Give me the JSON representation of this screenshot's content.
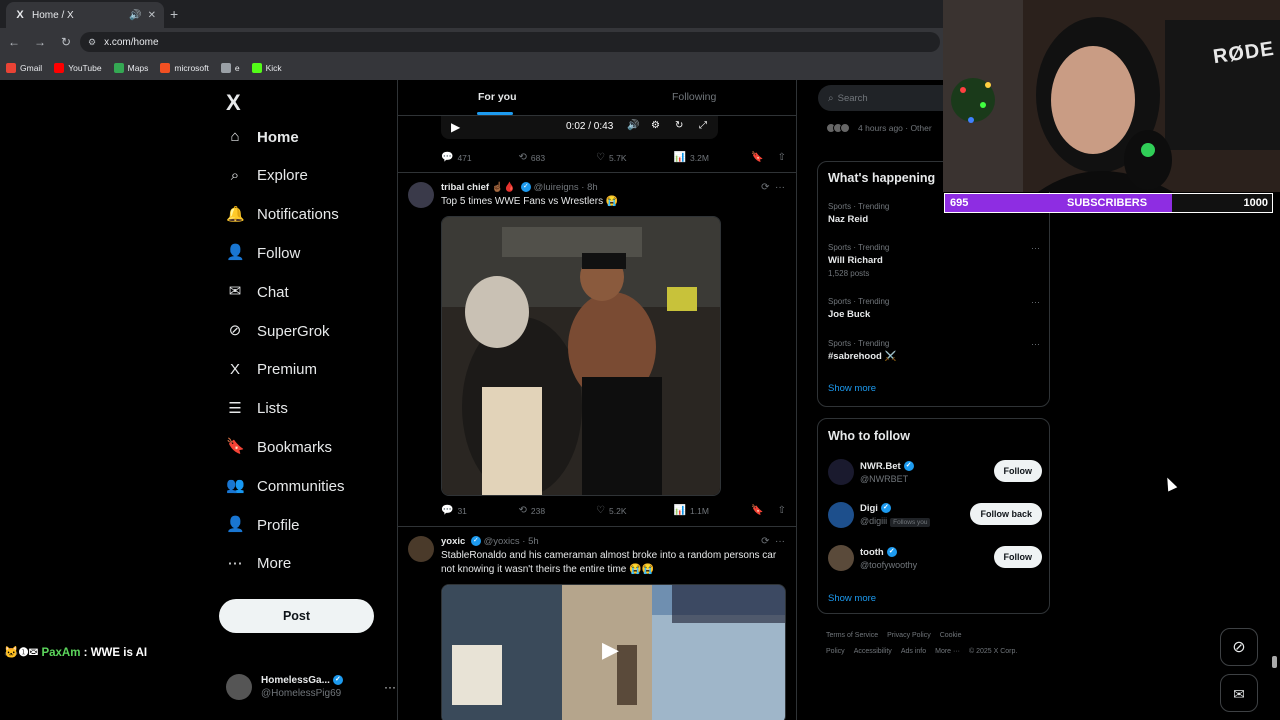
{
  "browser": {
    "tab_title": "Home / X",
    "tab_favicon": "X",
    "url": "x.com/home",
    "bookmarks": [
      {
        "label": "Gmail",
        "icon": "gmail-icon",
        "color": "#ea4335"
      },
      {
        "label": "YouTube",
        "icon": "youtube-icon",
        "color": "#ff0000"
      },
      {
        "label": "Maps",
        "icon": "maps-icon",
        "color": "#34a853"
      },
      {
        "label": "microsoft",
        "icon": "microsoft-icon",
        "color": "#f25022"
      },
      {
        "label": "e",
        "icon": "globe-icon",
        "color": "#9aa0a6"
      },
      {
        "label": "Kick",
        "icon": "kick-icon",
        "color": "#53fc18"
      }
    ]
  },
  "nav": {
    "logo": "X",
    "items": [
      {
        "label": "Home",
        "icon": "home-icon"
      },
      {
        "label": "Explore",
        "icon": "search-icon"
      },
      {
        "label": "Notifications",
        "icon": "bell-icon"
      },
      {
        "label": "Follow",
        "icon": "follow-icon"
      },
      {
        "label": "Chat",
        "icon": "mail-icon"
      },
      {
        "label": "SuperGrok",
        "icon": "grok-icon"
      },
      {
        "label": "Premium",
        "icon": "x-premium-icon"
      },
      {
        "label": "Lists",
        "icon": "lists-icon"
      },
      {
        "label": "Bookmarks",
        "icon": "bookmark-icon"
      },
      {
        "label": "Communities",
        "icon": "communities-icon"
      },
      {
        "label": "Profile",
        "icon": "profile-icon"
      },
      {
        "label": "More",
        "icon": "more-icon"
      }
    ],
    "post_button": "Post",
    "account": {
      "name": "HomelessGa...",
      "handle": "@HomelessPig69"
    }
  },
  "stream_chat": {
    "user": "PaxAm",
    "message": ": WWE is AI"
  },
  "timeline": {
    "tabs": [
      "For you",
      "Following"
    ],
    "top_video": {
      "time": "0:02 / 0:43"
    },
    "top_actions": {
      "replies": "471",
      "reposts": "683",
      "likes": "5.7K",
      "views": "3.2M"
    },
    "posts": [
      {
        "name": "tribal chief ☝🏾🩸",
        "handle": "@luireigns",
        "time": "8h",
        "text": "Top 5 times WWE Fans vs Wrestlers 😭",
        "actions": {
          "replies": "31",
          "reposts": "238",
          "likes": "5.2K",
          "views": "1.1M"
        }
      },
      {
        "name": "yoxic",
        "handle": "@yoxics",
        "time": "5h",
        "text": "StableRonaldo and his cameraman almost broke into a random persons car not knowing it wasn't theirs the entire time 😭😭"
      }
    ]
  },
  "sidebar": {
    "search_placeholder": "Search",
    "other_text": "4 hours ago · Other",
    "trending_title": "What's happening",
    "trends": [
      {
        "category": "Sports · Trending",
        "name": "Naz Reid",
        "posts": ""
      },
      {
        "category": "Sports · Trending",
        "name": "Will Richard",
        "posts": "1,528 posts"
      },
      {
        "category": "Sports · Trending",
        "name": "Joe Buck",
        "posts": ""
      },
      {
        "category": "Sports · Trending",
        "name": "#sabrehood ⚔️",
        "posts": ""
      }
    ],
    "show_more": "Show more",
    "who_to_follow_title": "Who to follow",
    "follow_suggestions": [
      {
        "name": "NWR.Bet",
        "handle": "@NWRBET",
        "button": "Follow",
        "follows_you": ""
      },
      {
        "name": "Digi",
        "handle": "@digiii",
        "button": "Follow back",
        "follows_you": "Follows you"
      },
      {
        "name": "tooth",
        "handle": "@toofywoothy",
        "button": "Follow",
        "follows_you": ""
      }
    ],
    "footer": [
      "Terms of Service",
      "Privacy Policy",
      "Cookie Policy",
      "Accessibility",
      "Ads info",
      "More ···",
      "© 2025 X Corp."
    ]
  },
  "overlay": {
    "subscribers_current": "695",
    "subscribers_label": "SUBSCRIBERS",
    "subscribers_goal": "1000",
    "subscribers_progress": 0.695,
    "mic_brand": "RØDE"
  },
  "colors": {
    "accent": "#1d9bf0",
    "progress": "#8e2de2"
  }
}
